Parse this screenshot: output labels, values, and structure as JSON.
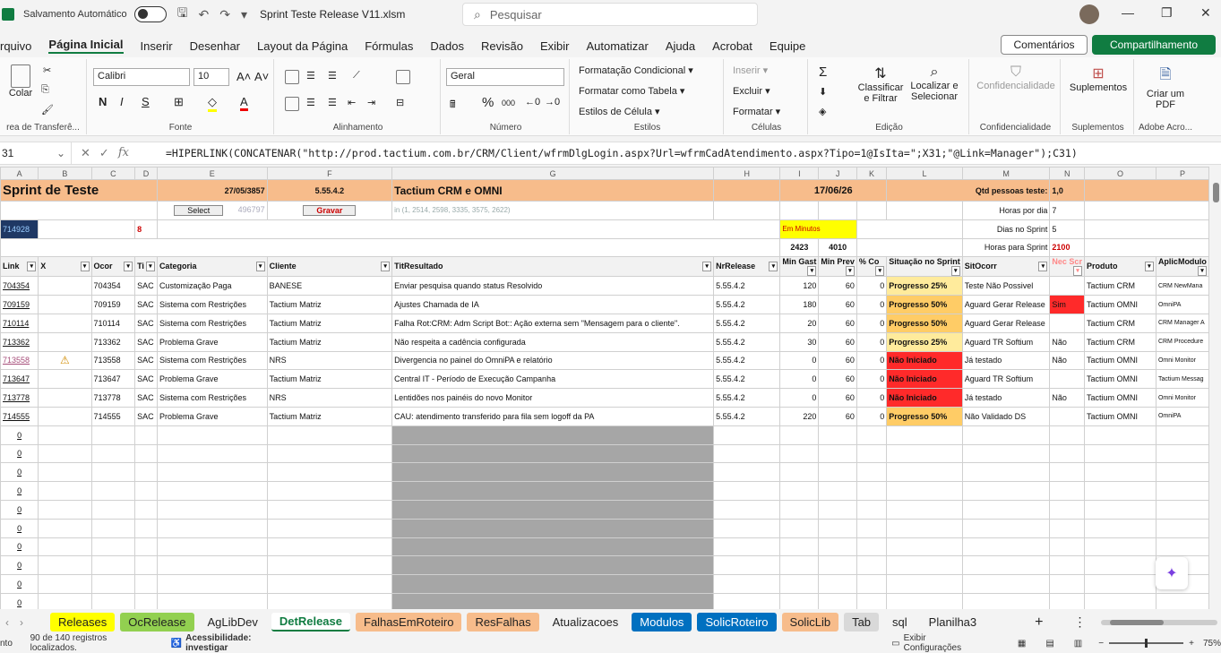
{
  "titlebar": {
    "autosave": "Salvamento Automático",
    "filename": "Sprint Teste Release V11.xlsm",
    "search_placeholder": "Pesquisar"
  },
  "menu": [
    "rquivo",
    "Página Inicial",
    "Inserir",
    "Desenhar",
    "Layout da Página",
    "Fórmulas",
    "Dados",
    "Revisão",
    "Exibir",
    "Automatizar",
    "Ajuda",
    "Acrobat",
    "Equipe"
  ],
  "menu_active": "Página Inicial",
  "buttons": {
    "comments": "Comentários",
    "share": "Compartilhamento"
  },
  "ribbon": {
    "clipboard": {
      "paste": "Colar",
      "label": "rea de Transferê..."
    },
    "font": {
      "name": "Calibri",
      "size": "10",
      "label": "Fonte"
    },
    "alignment": {
      "label": "Alinhamento"
    },
    "number": {
      "format": "Geral",
      "label": "Número"
    },
    "styles": {
      "conditional": "Formatação Condicional",
      "table": "Formatar como Tabela",
      "cell": "Estilos de Célula",
      "label": "Estilos"
    },
    "cells": {
      "insert": "Inserir",
      "delete": "Excluir",
      "format": "Formatar",
      "label": "Células"
    },
    "editing": {
      "sort": "Classificar e Filtrar",
      "find": "Localizar e Selecionar",
      "label": "Edição"
    },
    "sensitivity": {
      "btn": "Confidencialidade",
      "label": "Confidencialidade"
    },
    "addins": {
      "btn": "Suplementos",
      "label": "Suplementos"
    },
    "adobe": {
      "btn": "Criar um PDF",
      "label": "Adobe Acro..."
    }
  },
  "formula_bar": {
    "cell": "31",
    "formula": "=HIPERLINK(CONCATENAR(\"http://prod.tactium.com.br/CRM/Client/wfrmDlgLogin.aspx?Url=wfrmCadAtendimento.aspx?Tipo=1@IsIta=\";X31;\"@Link=Manager\");C31)"
  },
  "columns": [
    "A",
    "B",
    "C",
    "D",
    "E",
    "F",
    "G",
    "H",
    "I",
    "J",
    "K",
    "L",
    "M",
    "N",
    "O",
    "P"
  ],
  "sheet_top": {
    "title": "Sprint de Teste",
    "date1": "27/05/3857",
    "version": "5.55.4.2",
    "product": "Tactium CRM e OMNI",
    "date2": "17/06/26",
    "qtd_label": "Qtd pessoas teste:",
    "qtd_value": "1,0",
    "select_btn": "Select",
    "gravar_btn": "Gravar",
    "num_gray": "496797",
    "in_list": "in (1, 2514, 2598, 3335, 3575, 2622)",
    "horas_dia_label": "Horas por dia",
    "horas_dia": "7",
    "dias_label": "Dias no Sprint",
    "dias": "5",
    "em_minutos": "Em Minutos",
    "horas_sprint_label": "Horas para Sprint",
    "horas_sprint": "2100",
    "a3": "714928",
    "d3": "8",
    "i3": "2423",
    "j3": "4010"
  },
  "headers": [
    "Link",
    "X",
    "Ocor",
    "Ti",
    "Categoria",
    "Cliente",
    "TitResultado",
    "NrRelease",
    "Min Gast",
    "Min Prev",
    "% Co",
    "Situação no Sprint",
    "SitOcorr",
    "Nec Scr",
    "Produto",
    "AplicModulo"
  ],
  "rows": [
    [
      "704354",
      "",
      "704354",
      "SAC",
      "Customização Paga",
      "BANESE",
      "Enviar pesquisa quando status Resolvido",
      "5.55.4.2",
      "120",
      "60",
      "0",
      "Progresso 25%",
      "Teste Não Possivel",
      "",
      "Tactium CRM",
      "CRM NewMana"
    ],
    [
      "709159",
      "",
      "709159",
      "SAC",
      "Sistema com Restrições",
      "Tactium Matriz",
      "Ajustes Chamada de IA",
      "5.55.4.2",
      "180",
      "60",
      "0",
      "Progresso 50%",
      "Aguard Gerar Release",
      "Sim",
      "Tactium OMNI",
      "OmniPA"
    ],
    [
      "710114",
      "",
      "710114",
      "SAC",
      "Sistema com Restrições",
      "Tactium Matriz",
      "Falha Rot:CRM: Adm Script Bot:: Ação externa sem \"Mensagem para o cliente\".",
      "5.55.4.2",
      "20",
      "60",
      "0",
      "Progresso 50%",
      "Aguard Gerar Release",
      "",
      "Tactium CRM",
      "CRM Manager A"
    ],
    [
      "713362",
      "",
      "713362",
      "SAC",
      "Problema Grave",
      "Tactium Matriz",
      "Não respeita a cadência configurada",
      "5.55.4.2",
      "30",
      "60",
      "0",
      "Progresso 25%",
      "Aguard TR Softium",
      "Não",
      "Tactium CRM",
      "CRM Procedure"
    ],
    [
      "713558",
      "⚠",
      "713558",
      "SAC",
      "Sistema com Restrições",
      "NRS",
      "Divergencia no painel do OmniPA e relatório",
      "5.55.4.2",
      "0",
      "60",
      "0",
      "Não Iniciado",
      "Já testado",
      "Não",
      "Tactium OMNI",
      "Omni Monitor"
    ],
    [
      "713647",
      "",
      "713647",
      "SAC",
      "Problema Grave",
      "Tactium Matriz",
      "Central IT - Período de Execução Campanha",
      "5.55.4.2",
      "0",
      "60",
      "0",
      "Não Iniciado",
      "Aguard TR Softium",
      "",
      "Tactium OMNI",
      "Tactium Messag"
    ],
    [
      "713778",
      "",
      "713778",
      "SAC",
      "Sistema com Restrições",
      "NRS",
      "Lentidões nos painéis do novo Monitor",
      "5.55.4.2",
      "0",
      "60",
      "0",
      "Não Iniciado",
      "Já testado",
      "Não",
      "Tactium OMNI",
      "Omni Monitor"
    ],
    [
      "714555",
      "",
      "714555",
      "SAC",
      "Problema Grave",
      "Tactium Matriz",
      "CAU: atendimento transferido para fila sem logoff da PA",
      "5.55.4.2",
      "220",
      "60",
      "0",
      "Progresso 50%",
      "Não Validado DS",
      "",
      "Tactium OMNI",
      "OmniPA"
    ]
  ],
  "empty_link": "0",
  "sheet_tabs": [
    {
      "name": "Releases",
      "color": "#ffff00"
    },
    {
      "name": "OcRelease",
      "color": "#92d050"
    },
    {
      "name": "AgLibDev",
      "color": ""
    },
    {
      "name": "DetRelease",
      "color": "active"
    },
    {
      "name": "FalhasEmRoteiro",
      "color": "#f7bc8b"
    },
    {
      "name": "ResFalhas",
      "color": "#f7bc8b"
    },
    {
      "name": "Atualizacoes",
      "color": ""
    },
    {
      "name": "Modulos",
      "color": "#0070c0"
    },
    {
      "name": "SolicRoteiro",
      "color": "#0070c0"
    },
    {
      "name": "SolicLib",
      "color": "#f7bc8b"
    },
    {
      "name": "Tab",
      "color": "#d9d9d9"
    },
    {
      "name": "sql",
      "color": ""
    },
    {
      "name": "Planilha3",
      "color": ""
    }
  ],
  "status": {
    "left": "nto",
    "records": "90 de 140 registros localizados.",
    "access": "Acessibilidade: investigar",
    "display": "Exibir Configurações",
    "zoom": "75%"
  }
}
